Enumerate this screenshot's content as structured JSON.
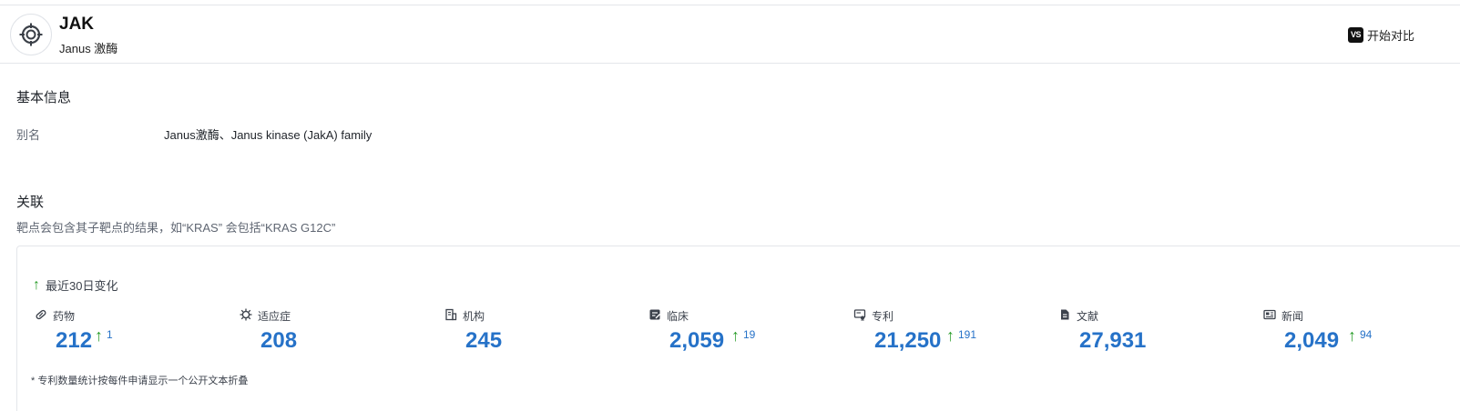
{
  "header": {
    "title": "JAK",
    "subtitle": "Janus 激酶",
    "compare_icon": "VS",
    "compare_label": "开始对比"
  },
  "basic_info": {
    "section_title": "基本信息",
    "alias_label": "别名",
    "alias_value": "Janus激酶、Janus kinase (JakA) family"
  },
  "relations": {
    "section_title": "关联",
    "note": "靶点会包含其子靶点的结果，如“KRAS” 会包括“KRAS G12C”",
    "recent_label": "最近30日变化",
    "footnote": "* 专利数量统计按每件申请显示一个公开文本折叠",
    "stats": [
      {
        "icon": "pill-icon",
        "label": "药物",
        "value": "212",
        "delta": "1"
      },
      {
        "icon": "virus-icon",
        "label": "适应症",
        "value": "208",
        "delta": ""
      },
      {
        "icon": "building-icon",
        "label": "机构",
        "value": "245",
        "delta": ""
      },
      {
        "icon": "clinical-icon",
        "label": "临床",
        "value": "2,059",
        "delta": "19"
      },
      {
        "icon": "patent-icon",
        "label": "专利",
        "value": "21,250",
        "delta": "191"
      },
      {
        "icon": "document-icon",
        "label": "文献",
        "value": "27,931",
        "delta": ""
      },
      {
        "icon": "news-icon",
        "label": "新闻",
        "value": "2,049",
        "delta": "94"
      }
    ]
  },
  "colors": {
    "accent": "#2672c8",
    "up_green": "#2a9d2a"
  }
}
